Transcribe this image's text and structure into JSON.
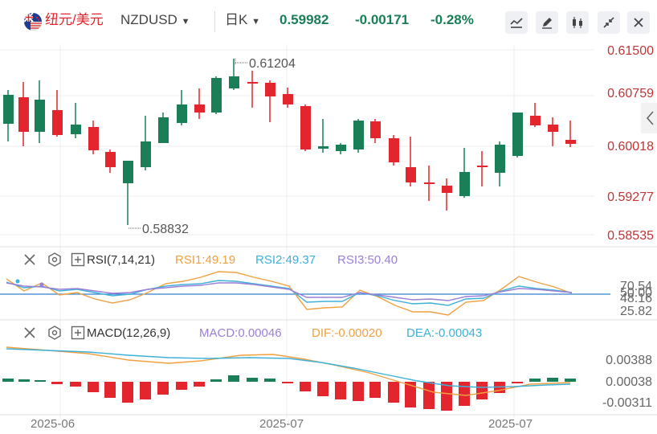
{
  "toolbar": {
    "pair_cn": "纽元/美元",
    "symbol": "NZDUSD",
    "interval": "日K",
    "price": "0.59982",
    "change": "-0.00171",
    "change_pct": "-0.28%",
    "icons": [
      "line-chart-icon",
      "draw-icon",
      "candle-type-icon",
      "collapse-icon",
      "close-icon"
    ]
  },
  "colors": {
    "up": "#1a7f56",
    "down": "#e3262d",
    "accent": "#1a7f56",
    "price_label": "#c03535"
  },
  "price_axis": {
    "labels": [
      "0.61500",
      "0.60759",
      "0.60018",
      "0.59277",
      "0.58535"
    ]
  },
  "annotations": {
    "high": "0.61204",
    "low": "0.58832"
  },
  "rsi": {
    "title": "RSI(7,14,21)",
    "rsi1": "RSI1:49.19",
    "rsi2": "RSI2:49.37",
    "rsi3": "RSI3:50.40",
    "axis": [
      "70.54",
      "50.00",
      "48.16",
      "25.82"
    ]
  },
  "macd": {
    "title": "MACD(12,26,9)",
    "macd": "MACD:0.00046",
    "dif": "DIF:-0.00020",
    "dea": "DEA:-0.00043",
    "axis": [
      "0.00388",
      "0.00038",
      "-0.00311"
    ]
  },
  "dates": [
    "2025-06",
    "2025-07",
    "2025-07"
  ]
}
